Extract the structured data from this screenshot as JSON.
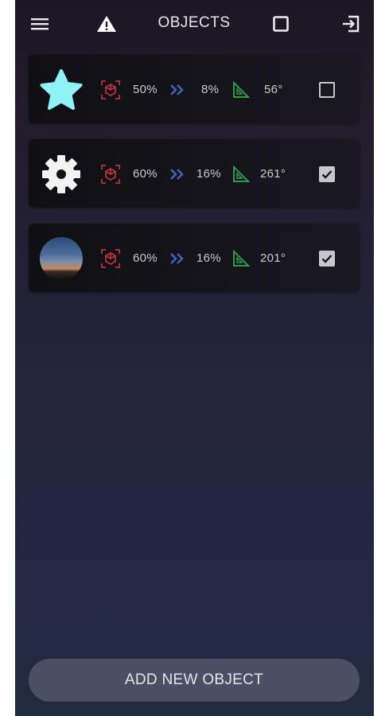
{
  "header": {
    "title": "OBJECTS",
    "icons": [
      "menu-icon",
      "warning-icon",
      "square-icon",
      "exit-icon"
    ]
  },
  "objects": [
    {
      "icon": "star-icon",
      "stat1": "50%",
      "stat2": "8%",
      "stat3": "56°",
      "checked": false
    },
    {
      "icon": "gear-icon",
      "stat1": "60%",
      "stat2": "16%",
      "stat3": "261°",
      "checked": true
    },
    {
      "icon": "photo-thumbnail",
      "stat1": "60%",
      "stat2": "16%",
      "stat3": "201°",
      "checked": true
    }
  ],
  "footer": {
    "add_label": "ADD NEW OBJECT"
  },
  "colors": {
    "star": "#8ff3f6",
    "target_red": "#b8343e",
    "speed_blue": "#3f63b8",
    "angle_green": "#2f9a4a",
    "button": "#4a4f63"
  }
}
